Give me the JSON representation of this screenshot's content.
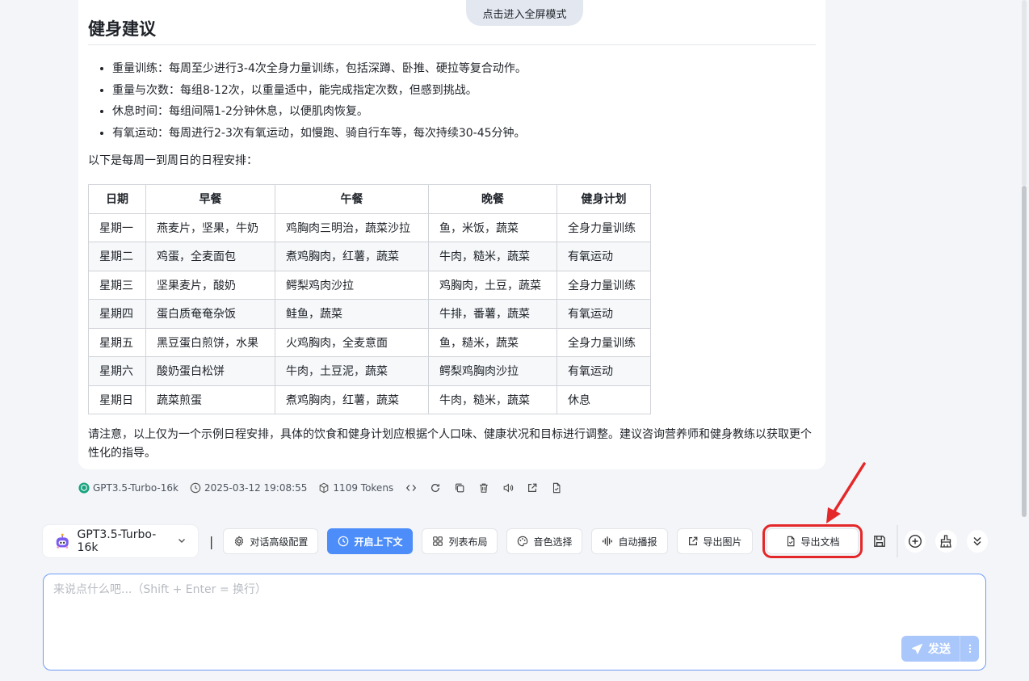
{
  "fullscreen_tab": "点击进入全屏模式",
  "message": {
    "title": "健身建议",
    "tips": [
      "重量训练：每周至少进行3-4次全身力量训练，包括深蹲、卧推、硬拉等复合动作。",
      "重量与次数：每组8-12次，以重量适中，能完成指定次数，但感到挑战。",
      "休息时间：每组间隔1-2分钟休息，以便肌肉恢复。",
      "有氧运动：每周进行2-3次有氧运动，如慢跑、骑自行车等，每次持续30-45分钟。"
    ],
    "intro": "以下是每周一到周日的日程安排：",
    "table": {
      "headers": [
        "日期",
        "早餐",
        "午餐",
        "晚餐",
        "健身计划"
      ],
      "rows": [
        [
          "星期一",
          "燕麦片，坚果，牛奶",
          "鸡胸肉三明治，蔬菜沙拉",
          "鱼，米饭，蔬菜",
          "全身力量训练"
        ],
        [
          "星期二",
          "鸡蛋，全麦面包",
          "煮鸡胸肉，红薯，蔬菜",
          "牛肉，糙米，蔬菜",
          "有氧运动"
        ],
        [
          "星期三",
          "坚果麦片，酸奶",
          "鳄梨鸡肉沙拉",
          "鸡胸肉，土豆，蔬菜",
          "全身力量训练"
        ],
        [
          "星期四",
          "蛋白质奄奄杂饭",
          "鲑鱼，蔬菜",
          "牛排，番薯，蔬菜",
          "有氧运动"
        ],
        [
          "星期五",
          "黑豆蛋白煎饼，水果",
          "火鸡胸肉，全麦意面",
          "鱼，糙米，蔬菜",
          "全身力量训练"
        ],
        [
          "星期六",
          "酸奶蛋白松饼",
          "牛肉，土豆泥，蔬菜",
          "鳄梨鸡胸肉沙拉",
          "有氧运动"
        ],
        [
          "星期日",
          "蔬菜煎蛋",
          "煮鸡胸肉，红薯，蔬菜",
          "牛肉，糙米，蔬菜",
          "休息"
        ]
      ]
    },
    "note": "请注意，以上仅为一个示例日程安排，具体的饮食和健身计划应根据个人口味、健康状况和目标进行调整。建议咨询营养师和健身教练以获取更个性化的指导。"
  },
  "meta": {
    "model": "GPT3.5-Turbo-16k",
    "timestamp": "2025-03-12 19:08:55",
    "tokens": "1109 Tokens"
  },
  "toolbar": {
    "model_label": "GPT3.5-Turbo-16k",
    "separator": "|",
    "buttons": {
      "advanced": "对话高级配置",
      "context": "开启上下文",
      "layout": "列表布局",
      "voice": "音色选择",
      "autoplay": "自动播报",
      "export_image": "导出图片",
      "export_doc": "导出文档"
    }
  },
  "input": {
    "placeholder": "来说点什么吧...（Shift + Enter = 换行）",
    "send_label": "发送"
  },
  "colors": {
    "primary": "#4d8df9",
    "highlight": "#e4282a",
    "send_disabled": "#a9c7fb"
  }
}
